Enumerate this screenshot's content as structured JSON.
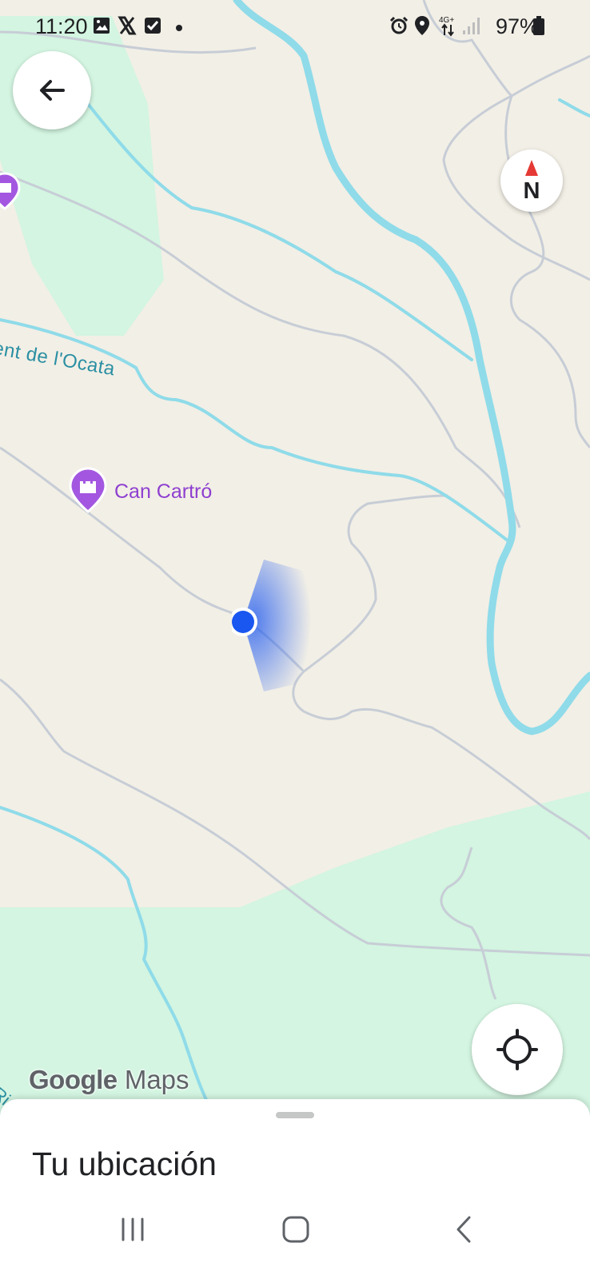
{
  "status_bar": {
    "time": "11:20",
    "battery": "97%",
    "network": "4G+",
    "icons": [
      "gallery-icon",
      "x-app-icon",
      "checkbox-icon",
      "dot-icon",
      "alarm-icon",
      "location-pin-icon",
      "data-arrows-icon",
      "signal-icon",
      "battery-icon"
    ]
  },
  "map": {
    "labels": {
      "river_ocata": "ent de l'Ocata",
      "river_riera": "Riera",
      "poi_name": "Can Cartró"
    },
    "compass_label": "N",
    "watermark_brand": "Google",
    "watermark_product": "Maps",
    "colors": {
      "land": "#f2efe6",
      "park": "#d3f5e1",
      "water": "#8fdbe9",
      "paths": "#c7cdd6",
      "poi": "#a357e0",
      "location_dot": "#1a56f0"
    }
  },
  "controls": {
    "back_icon": "arrow-left-icon",
    "compass_icon": "compass-icon",
    "locate_icon": "crosshair-icon"
  },
  "sheet": {
    "title": "Tu ubicación"
  },
  "nav_bar": {
    "buttons": [
      "recent-apps-icon",
      "home-icon",
      "back-icon"
    ]
  }
}
